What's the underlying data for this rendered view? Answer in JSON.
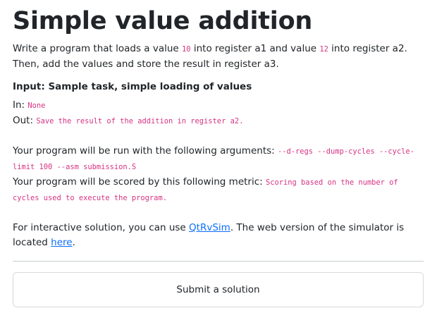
{
  "task": {
    "title": "Simple value addition",
    "description": {
      "part1": "Write a program that loads a value ",
      "value1": "10",
      "part2": " into register a1 and value ",
      "value2": "12",
      "part3": " into register a2. Then, add the values and store the result in register a3."
    },
    "input_heading": "Input: Sample task, simple loading of values",
    "in_label": "In: ",
    "in_value": "None",
    "out_label": "Out: ",
    "out_value": "Save the result of the addition in register a2.",
    "arguments_label": "Your program will be run with the following arguments: ",
    "arguments_value": "--d-regs --dump-cycles --cycle-limit 100 --asm submission.S",
    "metric_label": "Your program will be scored by this following metric: ",
    "metric_value": "Scoring based on the number of cycles used to execute the program.",
    "interactive": {
      "part1": "For interactive solution, you can use ",
      "link1": "QtRvSim",
      "part2": ". The web version of the simulator is located ",
      "link2": "here",
      "part3": "."
    }
  },
  "submit_button": {
    "label": "Submit a solution"
  },
  "colors": {
    "code": "#d63384",
    "link": "#0d6efd",
    "text": "#212529"
  }
}
